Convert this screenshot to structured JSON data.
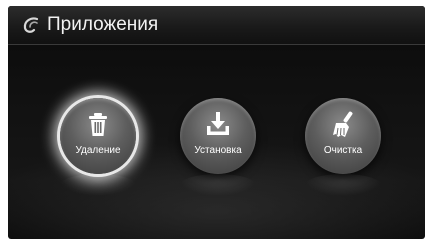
{
  "header": {
    "title": "Приложения",
    "logo_icon": "swirl-logo-icon"
  },
  "tiles": [
    {
      "label": "Удаление",
      "icon": "trash-icon",
      "selected": true
    },
    {
      "label": "Установка",
      "icon": "download-tray-icon",
      "selected": false
    },
    {
      "label": "Очистка",
      "icon": "broom-icon",
      "selected": false
    }
  ],
  "colors": {
    "background": "#111111",
    "tile": "#5e5e5e",
    "highlight": "#ffffff",
    "text": "#ffffff"
  }
}
